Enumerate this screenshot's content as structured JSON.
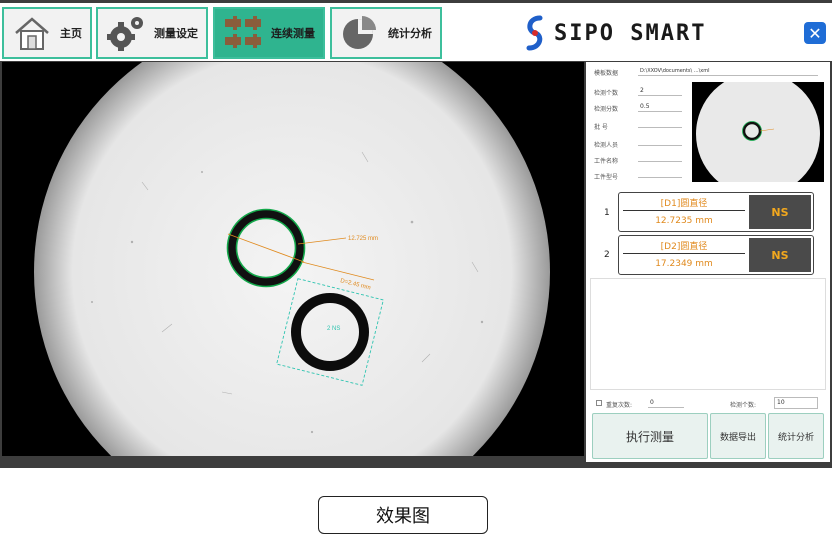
{
  "nav": {
    "home_label": "主页",
    "settings_label": "测量设定",
    "continuous_label": "连续测量",
    "stats_label": "统计分析"
  },
  "brand": {
    "logo_text": "SIPO SMART"
  },
  "viewer": {
    "circle1_label": "12.725 mm",
    "circle1_diag_label": "D=2.45 mm",
    "circle2_label": "2 NS"
  },
  "panel": {
    "template_label": "模板数据",
    "template_value": "D:\\XXOV\\documents\\ ...\\xml",
    "count_label": "检测个数",
    "count_value": "2",
    "precision_label": "检测分数",
    "precision_value": "0.5",
    "batch_label": "批 号",
    "inspector_label": "检测人员",
    "part_name_label": "工件名称",
    "part_model_label": "工件型号",
    "results": [
      {
        "index": "1",
        "title": "[D1]圆直径",
        "value": "12.7235 mm",
        "status": "NS"
      },
      {
        "index": "2",
        "title": "[D2]圆直径",
        "value": "17.2349 mm",
        "status": "NS"
      }
    ],
    "repeat_label": "重复次数:",
    "repeat_value": "0",
    "detect_count_label": "检测个数:",
    "detect_count_value": "10",
    "run_button": "执行测量",
    "export_button": "数据导出",
    "stats_button": "统计分析"
  },
  "caption": "效果图",
  "colors": {
    "accent": "#2fb48f",
    "orange": "#e08a1e",
    "green_ring": "#13a84a",
    "cyan_box": "#2ec4b0"
  }
}
